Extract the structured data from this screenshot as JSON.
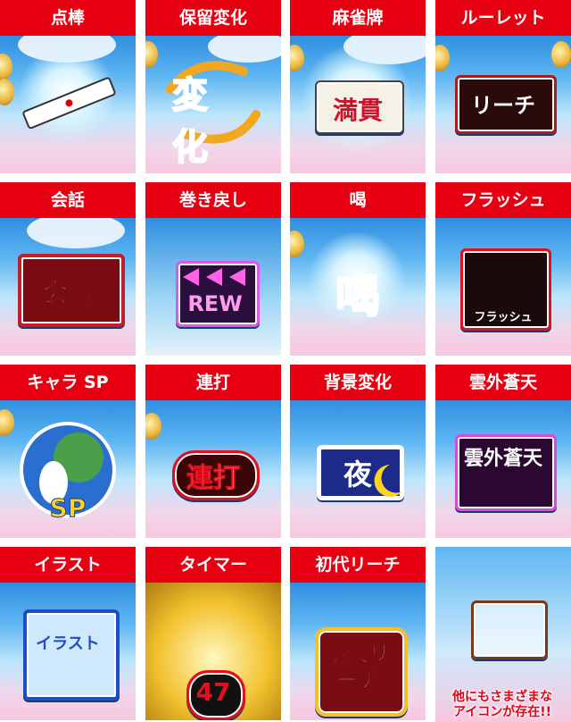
{
  "tiles": [
    {
      "label": "点棒",
      "icon": "point-stick-icon"
    },
    {
      "label": "保留変化",
      "icon": "hold-change-icon",
      "text": "変化"
    },
    {
      "label": "麻雀牌",
      "icon": "mahjong-tile-icon",
      "text": "満貫"
    },
    {
      "label": "ルーレット",
      "icon": "roulette-icon",
      "text": "リーチ"
    },
    {
      "label": "会話",
      "icon": "conversation-icon",
      "text": "会話"
    },
    {
      "label": "巻き戻し",
      "icon": "rewind-icon",
      "text": "REW"
    },
    {
      "label": "喝",
      "icon": "katsu-icon",
      "text": "喝"
    },
    {
      "label": "フラッシュ",
      "icon": "flash-icon",
      "text": "フラッシュ"
    },
    {
      "label": "キャラ SP",
      "icon": "character-sp-icon",
      "text": "SP"
    },
    {
      "label": "連打",
      "icon": "rapid-press-icon",
      "text": "連打"
    },
    {
      "label": "背景変化",
      "icon": "background-change-icon",
      "text": "夜"
    },
    {
      "label": "雲外蒼天",
      "icon": "ungaisouten-icon",
      "text": "雲外蒼天"
    },
    {
      "label": "イラスト",
      "icon": "illustration-icon",
      "text": "イラスト"
    },
    {
      "label": "タイマー",
      "icon": "timer-icon",
      "text": "47"
    },
    {
      "label": "初代リーチ",
      "icon": "first-reach-icon",
      "text": "初代リーチ"
    }
  ],
  "last_tile": {
    "icon": "treasure-box-icon",
    "caption_line1": "他にもさまざまな",
    "caption_line2": "アイコンが存在!!"
  },
  "colors": {
    "label_bg": "#e60012",
    "accent_blue": "#1e5fc0",
    "accent_gold": "#f2c12e"
  }
}
